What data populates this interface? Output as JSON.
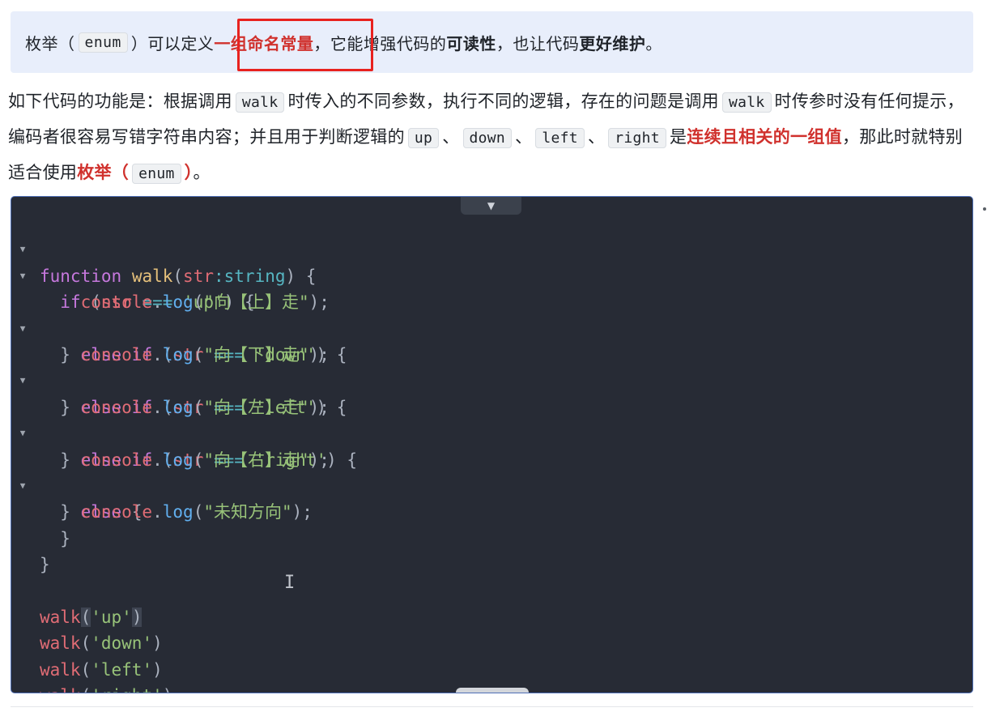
{
  "note": {
    "t1": "枚举（",
    "code": "enum",
    "t2": "）可以定义",
    "highlight": "一组命名常量",
    "t3": "，它能增强代码的",
    "bold1": "可读性",
    "t4": "，也让代码",
    "bold2": "更好维护",
    "t5": "。"
  },
  "para": {
    "s1": "如下代码的功能是：根据调用",
    "c1": "walk",
    "s2": "时传入的不同参数，执行不同的逻辑，存在的问题是调用",
    "c2": "walk",
    "s3": "时传参时没有任何提示，编码者很容易写错字符串内容；并且用于判断逻辑的",
    "c3": "up",
    "sep": "、",
    "c4": "down",
    "c5": "left",
    "c6": "right",
    "s4": "是",
    "red1": "连续且相关的一组值",
    "s5": "，那此时就特别适合使用",
    "red2a": "枚举（",
    "c7": "enum",
    "red2b": "）",
    "s6": "。"
  },
  "code": {
    "l1": {
      "kw": "function",
      "name": "walk",
      "p": "str",
      "colon": ":",
      "type": "string",
      "tail": ") {"
    },
    "l2": {
      "kw": "if",
      "p": "str",
      "op": "===",
      "s": "'up'"
    },
    "l3": {
      "obj": "console",
      "m": "log",
      "s": "\"向【上】走\""
    },
    "l4": {
      "kw": "else if",
      "p": "str",
      "op": "===",
      "s": "'down'"
    },
    "l5": {
      "obj": "console",
      "m": "log",
      "s": "\"向【下】走\""
    },
    "l6": {
      "kw": "else if",
      "p": "str",
      "op": "===",
      "s": "'left'"
    },
    "l7": {
      "obj": "console",
      "m": "log",
      "s": "\"向【左】走\""
    },
    "l8": {
      "kw": "else if",
      "p": "str",
      "op": "===",
      "s": "'right'"
    },
    "l9": {
      "obj": "console",
      "m": "log",
      "s": "\"向【右】走\""
    },
    "l10": {
      "kw": "else"
    },
    "l11": {
      "obj": "console",
      "m": "log",
      "s": "\"未知方向\""
    },
    "calls": [
      {
        "fn": "walk",
        "arg": "'up'"
      },
      {
        "fn": "walk",
        "arg": "'down'"
      },
      {
        "fn": "walk",
        "arg": "'left'"
      },
      {
        "fn": "walk",
        "arg": "'right'"
      }
    ]
  },
  "icons": {
    "collapse": "caret-down-icon",
    "fold": "fold-caret-icon",
    "cursor": "text-cursor-icon"
  },
  "colors": {
    "highlight_red": "#d0312d",
    "note_bg": "#e8eefb",
    "code_bg": "#272b35",
    "box_red": "#e8221f"
  }
}
